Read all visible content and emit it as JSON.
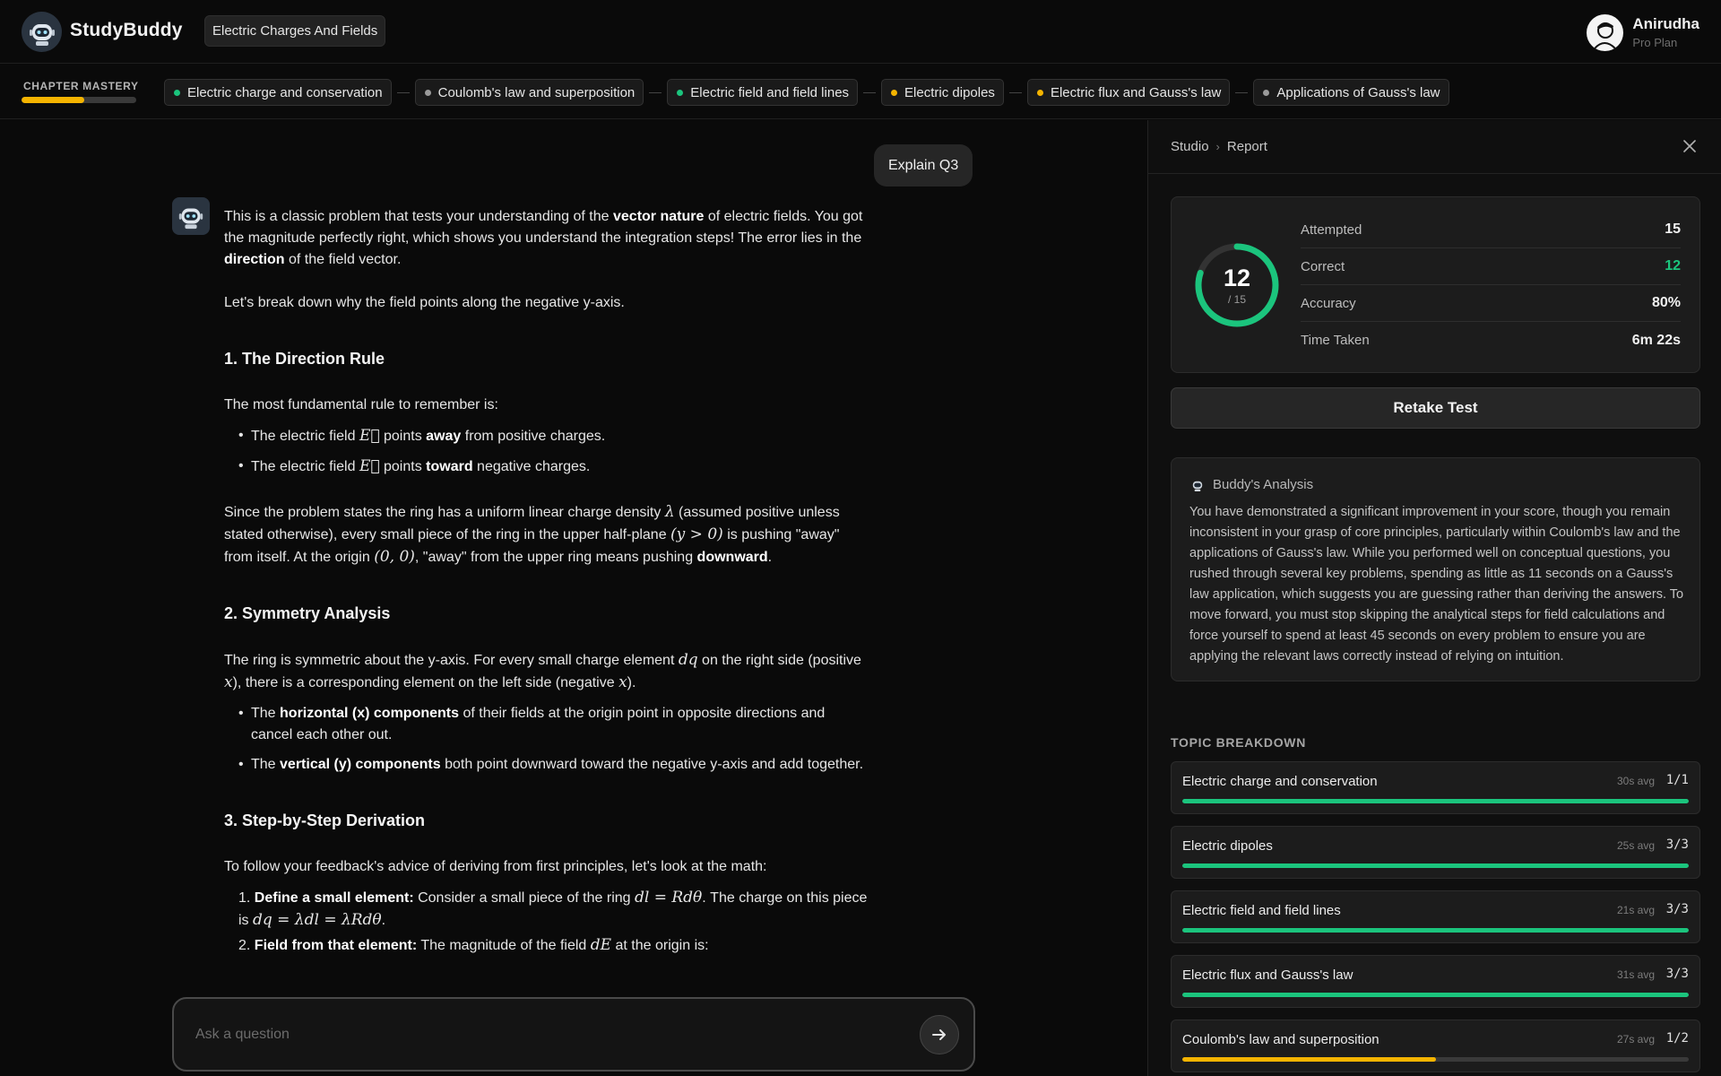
{
  "app": {
    "name": "StudyBuddy",
    "chapter": "Electric Charges And Fields"
  },
  "user": {
    "name": "Anirudha",
    "plan": "Pro Plan"
  },
  "mastery": {
    "label": "CHAPTER MASTERY",
    "fraction": 0.55,
    "color": "#f5b400",
    "topics": [
      {
        "label": "Electric charge and conservation",
        "status": "green"
      },
      {
        "label": "Coulomb's law and superposition",
        "status": "gray"
      },
      {
        "label": "Electric field and field lines",
        "status": "green"
      },
      {
        "label": "Electric dipoles",
        "status": "yellow"
      },
      {
        "label": "Electric flux and Gauss's law",
        "status": "yellow"
      },
      {
        "label": "Applications of Gauss's law",
        "status": "gray"
      }
    ]
  },
  "colors": {
    "green": "#1bc47d",
    "yellow": "#f5b400",
    "gray": "#9a9a9a"
  },
  "chat": {
    "user_message": "Explain Q3",
    "answer": {
      "intro_1": "This is a classic problem that tests your understanding of the ",
      "intro_bold_1": "vector nature",
      "intro_2": " of electric fields. You got the magnitude perfectly right, which shows you understand the integration steps! The error lies in the ",
      "intro_bold_2": "direction",
      "intro_3": " of the field vector.",
      "breakdown_line": "Let's break down why the field points along the negative y-axis.",
      "h1": "1. The Direction Rule",
      "rule_intro": "The most fundamental rule to remember is:",
      "rule_a_pre": "The electric field ",
      "rule_a_mid": " points ",
      "rule_a_bold": "away",
      "rule_a_post": " from positive charges.",
      "rule_b_pre": "The electric field ",
      "rule_b_mid": " points ",
      "rule_b_bold": "toward",
      "rule_b_post": " negative charges.",
      "ring_1": "Since the problem states the ring has a uniform linear charge density ",
      "ring_2": " (assumed positive unless stated otherwise), every small piece of the ring in the upper half-plane ",
      "ring_3": " is pushing \"away\" from itself. At the origin ",
      "ring_4": ", \"away\" from the upper ring means pushing ",
      "ring_bold": "downward",
      "ring_5": ".",
      "h2": "2. Symmetry Analysis",
      "sym_1": "The ring is symmetric about the y-axis. For every small charge element ",
      "sym_2": " on the right side (positive ",
      "sym_3": "), there is a corresponding element on the left side (negative ",
      "sym_4": ").",
      "sym_a_pre": "The ",
      "sym_a_bold": "horizontal (x) components",
      "sym_a_post": " of their fields at the origin point in opposite directions and cancel each other out.",
      "sym_b_pre": "The ",
      "sym_b_bold": "vertical (y) components",
      "sym_b_post": " both point downward toward the negative y-axis and add together.",
      "h3": "3. Step-by-Step Derivation",
      "deriv_intro": "To follow your feedback's advice of deriving from first principles, let's look at the math:",
      "step1_num": "1. ",
      "step1_bold": "Define a small element:",
      "step1_a": " Consider a small piece of the ring ",
      "step1_b": ". The charge on this piece is ",
      "step1_c": ".",
      "step2_num": "2. ",
      "step2_bold": "Field from that element:",
      "step2_a": " The magnitude of the field ",
      "step2_b": " at the origin is:",
      "math": {
        "E": "E⃗",
        "lambda": "λ",
        "y_gt_0": "(y > 0)",
        "origin": "(0, 0)",
        "dq": "dq",
        "x": "x",
        "dl_eq": "dl = Rdθ",
        "dq_eq": "dq = λdl = λRdθ",
        "dE": "dE"
      }
    },
    "input_placeholder": "Ask a question"
  },
  "panel": {
    "crumb_1": "Studio",
    "crumb_2": "Report",
    "score": {
      "correct": 12,
      "total": 15,
      "correct_text": "12",
      "total_text": "/ 15",
      "stats": [
        {
          "label": "Attempted",
          "value": "15",
          "tone": "default"
        },
        {
          "label": "Correct",
          "value": "12",
          "tone": "green"
        },
        {
          "label": "Accuracy",
          "value": "80%",
          "tone": "default"
        },
        {
          "label": "Time Taken",
          "value": "6m 22s",
          "tone": "default"
        }
      ]
    },
    "retake_label": "Retake Test",
    "analysis": {
      "title": "Buddy's Analysis",
      "body": "You have demonstrated a significant improvement in your score, though you remain inconsistent in your grasp of core principles, particularly within Coulomb's law and the applications of Gauss's law. While you performed well on conceptual questions, you rushed through several key problems, spending as little as 11 seconds on a Gauss's law application, which suggests you are guessing rather than deriving the answers. To move forward, you must stop skipping the analytical steps for field calculations and force yourself to spend at least 45 seconds on every problem to ensure you are applying the relevant laws correctly instead of relying on intuition."
    },
    "breakdown_title": "TOPIC BREAKDOWN",
    "breakdown": [
      {
        "name": "Electric charge and conservation",
        "avg": "30s avg",
        "score": "1/1",
        "fraction": 1.0,
        "status": "green"
      },
      {
        "name": "Electric dipoles",
        "avg": "25s avg",
        "score": "3/3",
        "fraction": 1.0,
        "status": "green"
      },
      {
        "name": "Electric field and field lines",
        "avg": "21s avg",
        "score": "3/3",
        "fraction": 1.0,
        "status": "green"
      },
      {
        "name": "Electric flux and Gauss's law",
        "avg": "31s avg",
        "score": "3/3",
        "fraction": 1.0,
        "status": "green"
      },
      {
        "name": "Coulomb's law and superposition",
        "avg": "27s avg",
        "score": "1/2",
        "fraction": 0.5,
        "status": "yellow"
      }
    ]
  }
}
